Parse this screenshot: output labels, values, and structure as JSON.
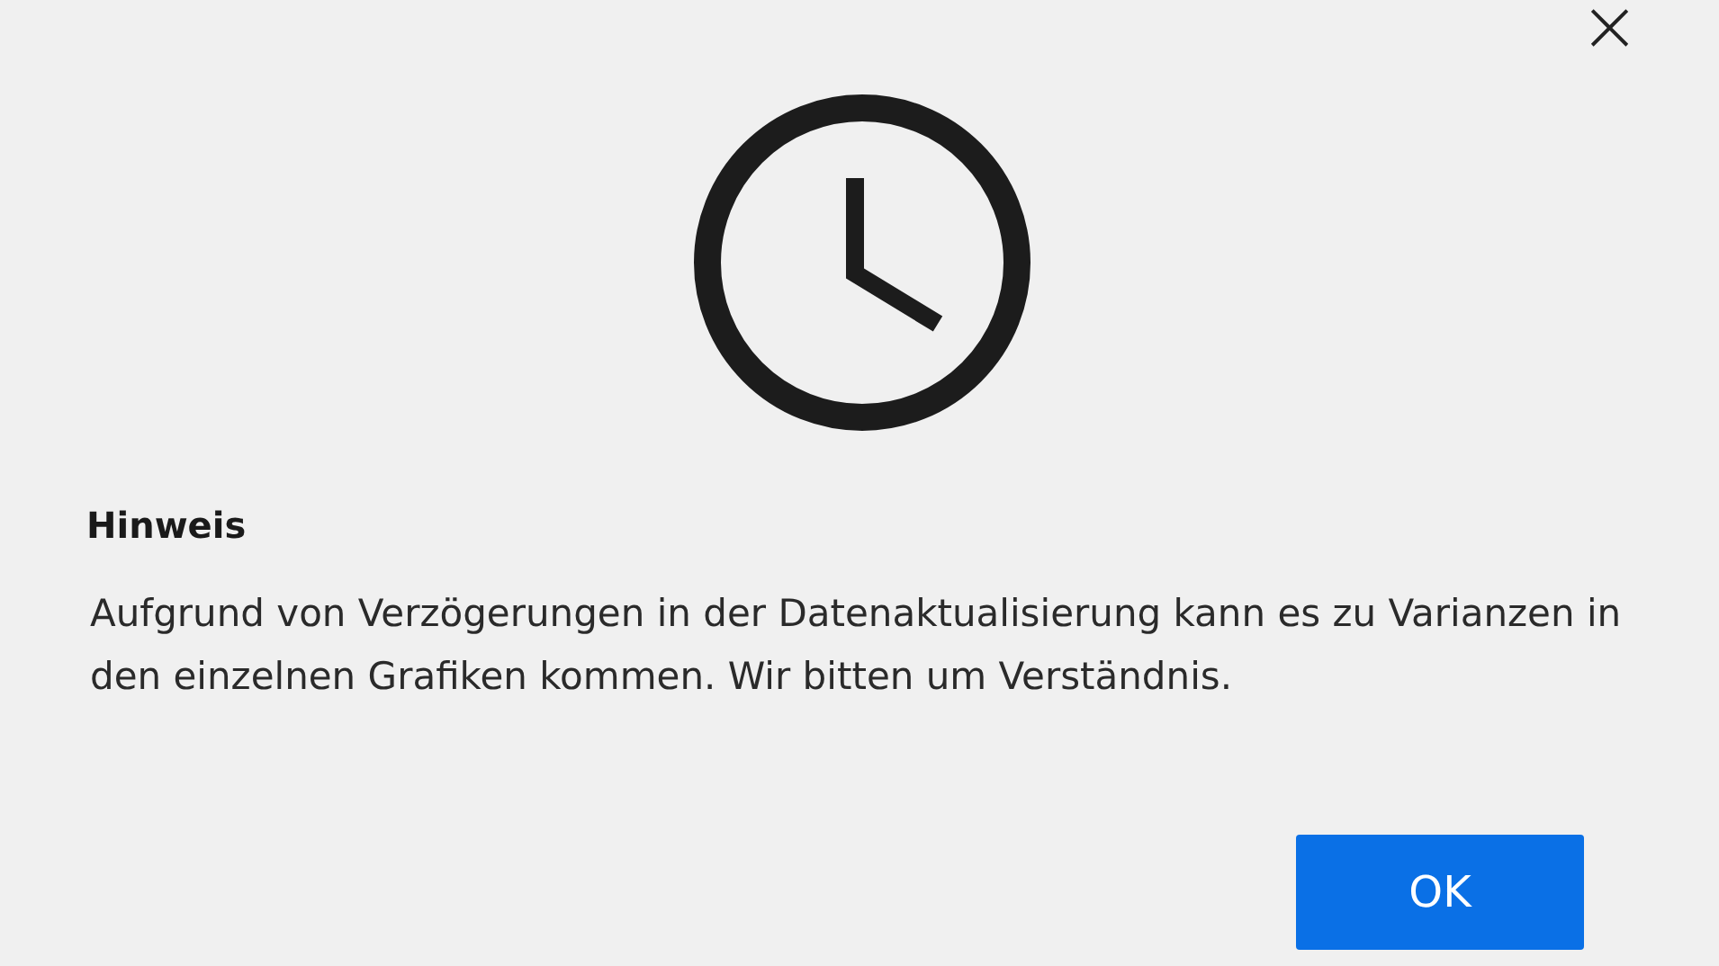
{
  "dialog": {
    "close_label": "×",
    "title": "Hinweis",
    "message": "Aufgrund von Verzögerungen in der Datenaktualisierung kann es zu Varianzen in den einzelnen Grafiken kommen. Wir bitten um Verständnis.",
    "buttons": [
      {
        "label": "OK",
        "kind": "primary"
      }
    ]
  }
}
